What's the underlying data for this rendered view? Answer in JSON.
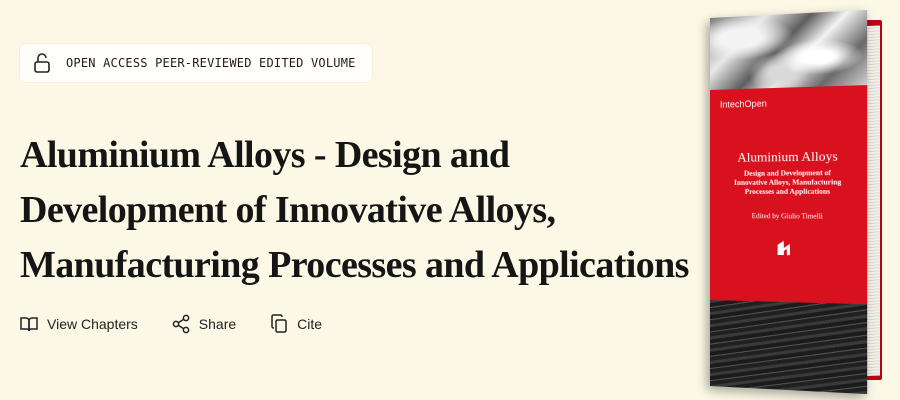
{
  "badge": {
    "icon": "lock-open-icon",
    "label": "OPEN ACCESS PEER-REVIEWED EDITED VOLUME"
  },
  "title_lines": [
    "Aluminium Alloys - Design and",
    "Development of Innovative Alloys,",
    "Manufacturing Processes and Applications"
  ],
  "actions": [
    {
      "icon": "book-open-icon",
      "label": "View Chapters"
    },
    {
      "icon": "share-icon",
      "label": "Share"
    },
    {
      "icon": "copy-icon",
      "label": "Cite"
    }
  ],
  "cover": {
    "publisher": "IntechOpen",
    "title": "Aluminium Alloys",
    "subtitle_lines": [
      "Design and Development of",
      "Innovative Alloys, Manufacturing",
      "Processes and Applications"
    ],
    "editor": "Edited by Giulio Timelli",
    "logo_icon": "intechopen-logo-icon",
    "accent_color": "#d9111f"
  }
}
